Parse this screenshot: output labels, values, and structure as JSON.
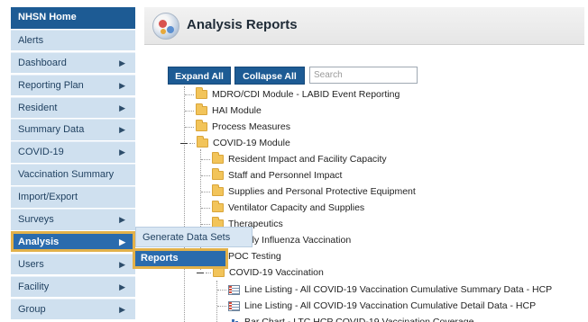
{
  "sidebar": {
    "items": [
      {
        "label": "NHSN Home",
        "chevron": false,
        "state": "home"
      },
      {
        "label": "Alerts",
        "chevron": false,
        "state": ""
      },
      {
        "label": "Dashboard",
        "chevron": true,
        "state": ""
      },
      {
        "label": "Reporting Plan",
        "chevron": true,
        "state": ""
      },
      {
        "label": "Resident",
        "chevron": true,
        "state": ""
      },
      {
        "label": "Summary Data",
        "chevron": true,
        "state": ""
      },
      {
        "label": "COVID-19",
        "chevron": true,
        "state": ""
      },
      {
        "label": "Vaccination Summary",
        "chevron": false,
        "state": ""
      },
      {
        "label": "Import/Export",
        "chevron": false,
        "state": ""
      },
      {
        "label": "Surveys",
        "chevron": true,
        "state": ""
      },
      {
        "label": "Analysis",
        "chevron": true,
        "state": "active"
      },
      {
        "label": "Users",
        "chevron": true,
        "state": ""
      },
      {
        "label": "Facility",
        "chevron": true,
        "state": ""
      },
      {
        "label": "Group",
        "chevron": true,
        "state": ""
      }
    ],
    "chevron_glyph": "▶"
  },
  "submenu": {
    "generate_label": "Generate Data Sets",
    "reports_label": "Reports"
  },
  "header": {
    "title": "Analysis Reports",
    "logo_icon": "analysis-reports-logo-icon"
  },
  "toolbar": {
    "expand_label": "Expand All",
    "collapse_label": "Collapse All",
    "search_placeholder": "Search"
  },
  "tree": {
    "nodes": [
      {
        "label": "MDRO/CDI Module - LABID Event Reporting",
        "icon": "folder-icon"
      },
      {
        "label": "HAI Module",
        "icon": "folder-icon"
      },
      {
        "label": "Process Measures",
        "icon": "folder-icon"
      },
      {
        "label": "COVID-19 Module",
        "icon": "folder-icon",
        "expanded": true
      },
      {
        "label": "Resident Impact and Facility Capacity",
        "icon": "folder-icon"
      },
      {
        "label": "Staff and Personnel Impact",
        "icon": "folder-icon"
      },
      {
        "label": "Supplies and Personal Protective Equipment",
        "icon": "folder-icon"
      },
      {
        "label": "Ventilator Capacity and Supplies",
        "icon": "folder-icon"
      },
      {
        "label": "Therapeutics",
        "icon": "folder-icon"
      },
      {
        "label": "Weekly Influenza Vaccination",
        "icon": "folder-icon"
      },
      {
        "label": "POC Testing",
        "icon": "folder-icon"
      },
      {
        "label": "COVID-19 Vaccination",
        "icon": "folder-icon",
        "expanded": true
      },
      {
        "label": "Line Listing - All COVID-19 Vaccination Cumulative Summary Data - HCP",
        "icon": "report-icon"
      },
      {
        "label": "Line Listing - All COVID-19 Vaccination Cumulative Detail Data - HCP",
        "icon": "report-icon"
      },
      {
        "label": "Bar Chart - LTC HCP COVID-19 Vaccination Coverage",
        "icon": "bar-chart-icon"
      }
    ]
  },
  "colors": {
    "nav_bg": "#cfe0ef",
    "nav_home": "#1d5b94",
    "nav_active": "#2a6bad",
    "highlight_outline": "#e2b14a",
    "button_bg": "#1d5b94",
    "folder": "#f2c45a"
  }
}
